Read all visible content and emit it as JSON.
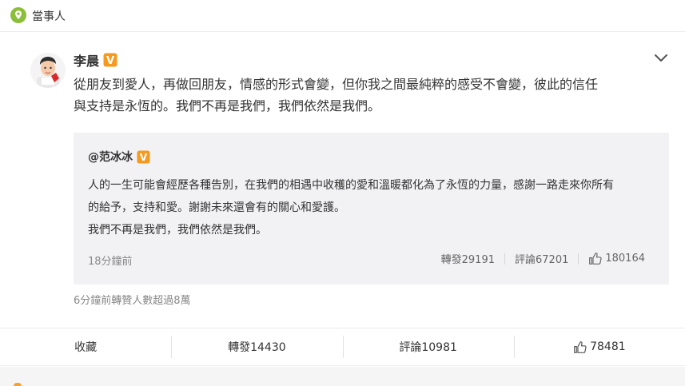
{
  "header": {
    "title": "當事人",
    "icon": "location-pin-icon",
    "accent_color": "#8bbf3a"
  },
  "post": {
    "author": {
      "name": "李晨",
      "verified_badge": "V",
      "badge_color": "#f49a1f"
    },
    "text_lines": [
      "從朋友到愛人，再做回朋友，情感的形式會變，但你我之間最純粹的感受不會變，彼此的信任",
      "與支持是永恆的。我們不再是我們，我們依然是我們。"
    ],
    "repost": {
      "author": "@范冰冰",
      "verified_badge": "V",
      "text_lines": [
        "人的一生可能會經歷各種告別，在我們的相遇中收穫的愛和溫暖都化為了永恆的力量，感謝一路走來你所有",
        "的給予，支持和愛。謝謝未來還會有的關心和愛護。",
        "我們不再是我們，我們依然是我們。"
      ],
      "time": "18分鐘前",
      "reposts": "轉發29191",
      "comments": "評論67201",
      "likes": "180164"
    },
    "views_note": "6分鐘前轉贊人數超過8萬"
  },
  "actions": {
    "favorite": "收藏",
    "repost": "轉發14430",
    "comment": "評論10981",
    "likes": "78481"
  }
}
